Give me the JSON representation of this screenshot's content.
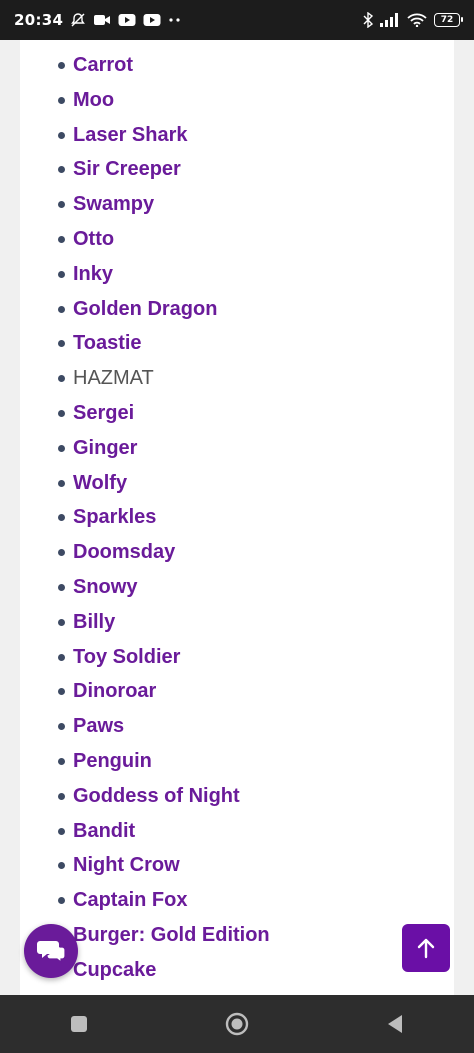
{
  "status_bar": {
    "time": "20:34",
    "battery": "72",
    "left_icons": [
      "alarm-off-icon",
      "video-camera-icon",
      "youtube-icon",
      "youtube-icon",
      "more-dots-icon"
    ],
    "right_icons": [
      "bluetooth-icon",
      "signal-icon",
      "wifi-icon",
      "battery-icon"
    ]
  },
  "names": [
    {
      "label": "Carrot",
      "link": true
    },
    {
      "label": "Moo",
      "link": true
    },
    {
      "label": "Laser Shark",
      "link": true
    },
    {
      "label": "Sir Creeper",
      "link": true
    },
    {
      "label": "Swampy",
      "link": true
    },
    {
      "label": "Otto",
      "link": true
    },
    {
      "label": "Inky",
      "link": true
    },
    {
      "label": "Golden Dragon",
      "link": true
    },
    {
      "label": "Toastie",
      "link": true
    },
    {
      "label": "HAZMAT",
      "link": false
    },
    {
      "label": "Sergei",
      "link": true
    },
    {
      "label": "Ginger",
      "link": true
    },
    {
      "label": "Wolfy",
      "link": true
    },
    {
      "label": "Sparkles",
      "link": true
    },
    {
      "label": "Doomsday",
      "link": true
    },
    {
      "label": "Snowy",
      "link": true
    },
    {
      "label": "Billy",
      "link": true
    },
    {
      "label": "Toy Soldier",
      "link": true
    },
    {
      "label": "Dinoroar",
      "link": true
    },
    {
      "label": "Paws",
      "link": true
    },
    {
      "label": "Penguin",
      "link": true
    },
    {
      "label": "Goddess of Night",
      "link": true
    },
    {
      "label": "Bandit",
      "link": true
    },
    {
      "label": "Night Crow",
      "link": true
    },
    {
      "label": "Captain Fox",
      "link": true
    },
    {
      "label": "Burger: Gold Edition",
      "link": true
    },
    {
      "label": "Cupcake",
      "link": true
    }
  ],
  "colors": {
    "link": "#6a1b9a",
    "plain_text": "#555555",
    "bullet": "#3d4a63",
    "fab": "#6a0fa6"
  },
  "fabs": {
    "chat_icon": "chat-bubbles-icon",
    "top_icon": "arrow-up-icon"
  },
  "nav_bar": {
    "buttons": [
      "recents-square-icon",
      "home-circle-icon",
      "back-triangle-icon"
    ]
  }
}
